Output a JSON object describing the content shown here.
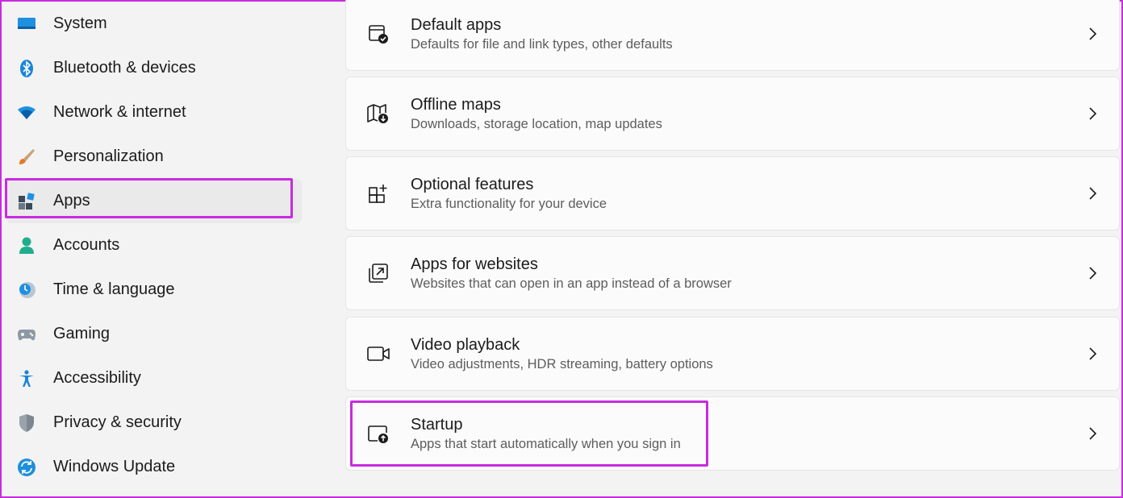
{
  "sidebar": {
    "items": [
      {
        "label": "System",
        "icon": "system-icon"
      },
      {
        "label": "Bluetooth & devices",
        "icon": "bluetooth-icon"
      },
      {
        "label": "Network & internet",
        "icon": "wifi-icon"
      },
      {
        "label": "Personalization",
        "icon": "brush-icon"
      },
      {
        "label": "Apps",
        "icon": "apps-icon",
        "selected": true
      },
      {
        "label": "Accounts",
        "icon": "person-icon"
      },
      {
        "label": "Time & language",
        "icon": "clock-globe-icon"
      },
      {
        "label": "Gaming",
        "icon": "controller-icon"
      },
      {
        "label": "Accessibility",
        "icon": "accessibility-icon"
      },
      {
        "label": "Privacy & security",
        "icon": "shield-icon"
      },
      {
        "label": "Windows Update",
        "icon": "update-icon"
      }
    ]
  },
  "cards": [
    {
      "title": "Default apps",
      "subtitle": "Defaults for file and link types, other defaults",
      "icon": "default-apps-icon"
    },
    {
      "title": "Offline maps",
      "subtitle": "Downloads, storage location, map updates",
      "icon": "map-download-icon"
    },
    {
      "title": "Optional features",
      "subtitle": "Extra functionality for your device",
      "icon": "optional-features-icon"
    },
    {
      "title": "Apps for websites",
      "subtitle": "Websites that can open in an app instead of a browser",
      "icon": "external-link-icon"
    },
    {
      "title": "Video playback",
      "subtitle": "Video adjustments, HDR streaming, battery options",
      "icon": "video-camera-icon"
    },
    {
      "title": "Startup",
      "subtitle": "Apps that start automatically when you sign in",
      "icon": "startup-icon"
    }
  ],
  "colors": {
    "highlight": "#c82be0",
    "accent": "#0078d4",
    "background": "#f3f3f3",
    "card": "#fbfbfb"
  }
}
